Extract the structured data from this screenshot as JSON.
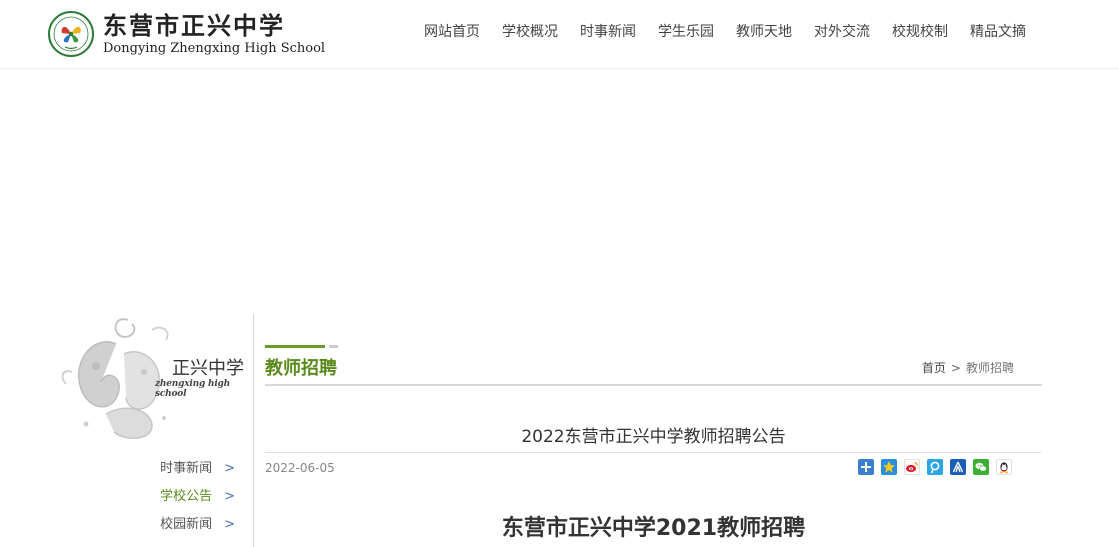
{
  "header": {
    "school_name_cn": "东营市正兴中学",
    "school_name_en": "Dongying Zhengxing High School",
    "nav": [
      "网站首页",
      "学校概况",
      "时事新闻",
      "学生乐园",
      "教师天地",
      "对外交流",
      "校规校制",
      "精品文摘"
    ]
  },
  "sidebar": {
    "title": "正兴中学",
    "subtitle": "zhengxing high school",
    "arrow": ">",
    "items": [
      {
        "label": "时事新闻"
      },
      {
        "label": "学校公告"
      },
      {
        "label": "校园新闻"
      }
    ]
  },
  "main": {
    "section_title": "教师招聘",
    "breadcrumb": {
      "home": "首页",
      "separator": ">",
      "current": "教师招聘"
    },
    "article": {
      "title": "2022东营市正兴中学教师招聘公告",
      "date": "2022-06-05",
      "heading": "东营市正兴中学2021教师招聘"
    },
    "share_icons": [
      "more-share-icon",
      "qzone-icon",
      "weibo-icon",
      "tencent-weibo-icon",
      "renren-icon",
      "wechat-icon",
      "qq-icon"
    ]
  },
  "colors": {
    "accent_green": "#5a8a1c",
    "link_arrow_blue": "#4a6fb5"
  }
}
